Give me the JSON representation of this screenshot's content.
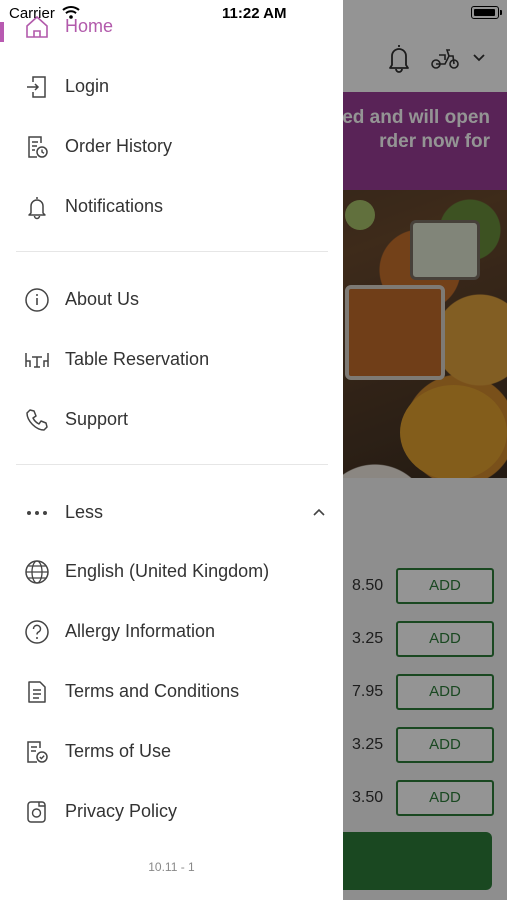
{
  "status_bar": {
    "carrier": "Carrier",
    "time": "11:22 AM"
  },
  "background": {
    "banner_text": "ed and will open\nrder now for",
    "menu_rows": [
      {
        "price": "8.50",
        "add_label": "ADD"
      },
      {
        "price": "3.25",
        "add_label": "ADD"
      },
      {
        "price": "7.95",
        "add_label": "ADD"
      },
      {
        "price": "3.25",
        "add_label": "ADD"
      },
      {
        "price": "3.50",
        "add_label": "ADD"
      }
    ],
    "accent_color": "#9a3d96",
    "button_color": "#2d7d3a"
  },
  "drawer": {
    "home_label": "Home",
    "primary_items": [
      {
        "label": "Login",
        "icon": "login-icon"
      },
      {
        "label": "Order History",
        "icon": "order-history-icon"
      },
      {
        "label": "Notifications",
        "icon": "bell-icon"
      }
    ],
    "secondary_items": [
      {
        "label": "About Us",
        "icon": "info-icon"
      },
      {
        "label": "Table Reservation",
        "icon": "table-icon"
      },
      {
        "label": "Support",
        "icon": "phone-icon"
      }
    ],
    "less_label": "Less",
    "more_items": [
      {
        "label": "English (United Kingdom)",
        "icon": "globe-icon"
      },
      {
        "label": "Allergy Information",
        "icon": "question-icon"
      },
      {
        "label": "Terms and Conditions",
        "icon": "document-icon"
      },
      {
        "label": "Terms of Use",
        "icon": "document-check-icon"
      },
      {
        "label": "Privacy Policy",
        "icon": "privacy-icon"
      }
    ],
    "version": "10.11 - 1",
    "active_color": "#b85ab1"
  }
}
